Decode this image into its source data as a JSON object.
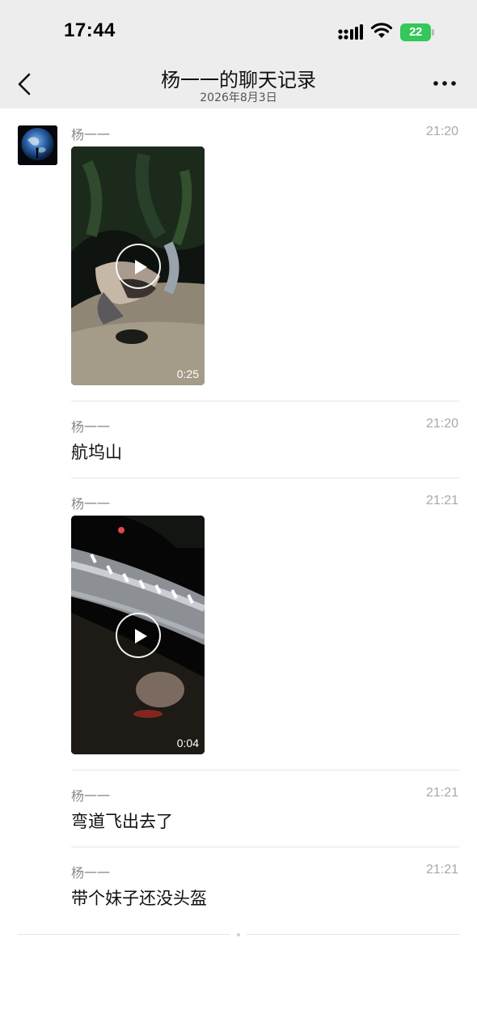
{
  "status_bar": {
    "time": "17:44",
    "battery": "22",
    "icons": [
      "signal-icon",
      "wifi-icon",
      "battery-icon"
    ],
    "battery_color": "#34c759"
  },
  "nav": {
    "title": "杨一一的聊天记录",
    "subtitle": "2026年8月3日",
    "icons": [
      "back-icon",
      "more-icon"
    ]
  },
  "messages": [
    {
      "sender": "杨一一",
      "time": "21:20",
      "type": "video",
      "duration": "0:25"
    },
    {
      "sender": "杨一一",
      "time": "21:20",
      "type": "text",
      "text": "航坞山"
    },
    {
      "sender": "杨一一",
      "time": "21:21",
      "type": "video",
      "duration": "0:04"
    },
    {
      "sender": "杨一一",
      "time": "21:21",
      "type": "text",
      "text": "弯道飞出去了"
    },
    {
      "sender": "杨一一",
      "time": "21:21",
      "type": "text",
      "text": "带个妹子还没头盔"
    }
  ],
  "colors": {
    "header_bg": "#ededed",
    "background": "#ffffff",
    "secondary_text": "#8a8a8a"
  }
}
